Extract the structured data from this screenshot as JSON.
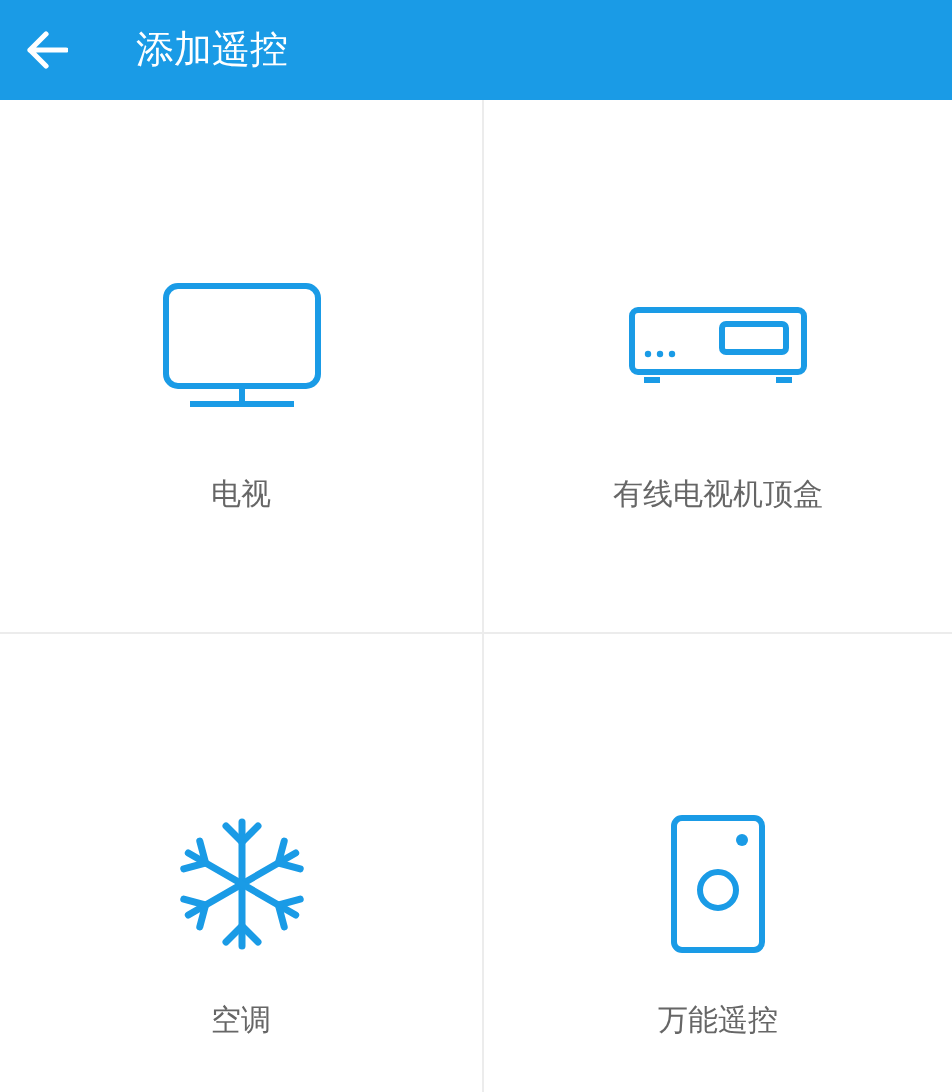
{
  "header": {
    "title": "添加遥控"
  },
  "devices": [
    {
      "kind": "tv",
      "label": "电视"
    },
    {
      "kind": "settop",
      "label": "有线电视机顶盒"
    },
    {
      "kind": "ac",
      "label": "空调"
    },
    {
      "kind": "universal",
      "label": "万能遥控"
    }
  ]
}
